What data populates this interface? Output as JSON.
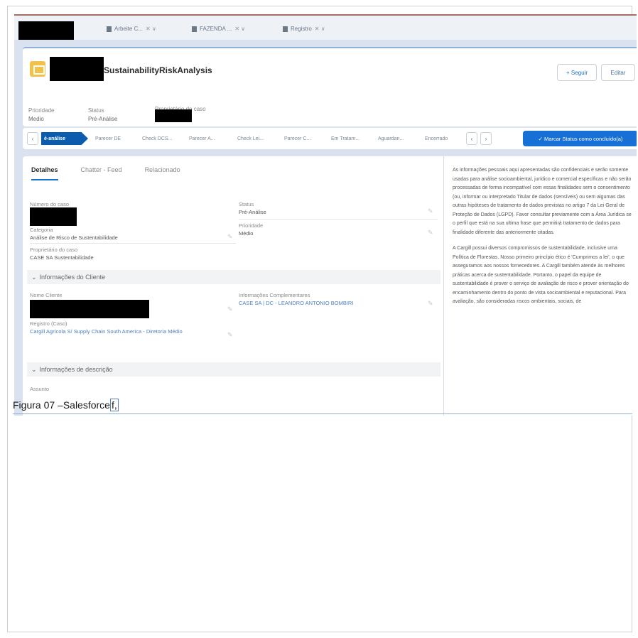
{
  "tabbar": {
    "tabs": [
      {
        "label": "Arbeite C...",
        "close": "✕ ∨"
      },
      {
        "label": "FAZENDA ...",
        "close": "✕ ∨"
      },
      {
        "label": "Registro",
        "close": "✕ ∨"
      }
    ]
  },
  "header": {
    "record_title": "SustainabilityRiskAnalysis",
    "follow_label": "+ Seguir",
    "edit_label": "Editar",
    "highlights": [
      {
        "label": "Prioridade",
        "value": "Medio"
      },
      {
        "label": "Status",
        "value": "Pré-Análise"
      },
      {
        "label": "Proprietário do caso",
        "value": ""
      }
    ]
  },
  "path": {
    "prev": "‹",
    "next": "›",
    "stages": [
      "é-análise",
      "Parecer DE",
      "Check DCS...",
      "Parecer A...",
      "Check Lei...",
      "Parecer C...",
      "Em Tratam...",
      "Aguardan...",
      "Encerrado"
    ],
    "mark_button": "✓ Marcar Status como concluído(a)"
  },
  "details": {
    "tabs": [
      "Detalhes",
      "Chatter - Feed",
      "Relacionado"
    ],
    "fields": {
      "numero_label": "Número do caso",
      "categoria_label": "Categoria",
      "categoria_value": "Análise de Risco de Sustentabilidade",
      "proprietario_label": "Proprietário do caso",
      "proprietario_value": "CASE SA Sustentabilidade",
      "status_label": "Status",
      "status_value": "Pré-Análise",
      "prioridade_label": "Prioridade",
      "prioridade_value": "Médio",
      "nome_cliente_label": "Nome Cliente",
      "registro_label": "Registro (Caso)",
      "registro_value": "Cargill Agrícola S/ Supply Chain South America - Diretoria Médio",
      "info_comp_label": "Informações Complementares",
      "info_comp_value": "CASE SA | DC - LEANDRO ANTONIO BOMBIRI",
      "assunto_label": "Assunto"
    },
    "sections": {
      "cliente": "Informações do Cliente",
      "descricao": "Informações de descrição"
    }
  },
  "right_panel": {
    "paragraphs": [
      "As informações pessoais aqui apresentadas são confidenciais e serão somente usadas para análise socioambiental, jurídico e comercial específicas e não serão processadas de forma incompatível com essas finalidades sem o consentimento (ou, informar ou interpretado Titular de dados (sensíveis) ou sem algumas das outras hipóteses de tratamento de dados previstas no artigo 7 da Lei Geral de Proteção de Dados (LGPD). Favor consultar previamente com a Área Jurídica se o perfil que está na sua ultima frase que permitirá tratamento de dados para finalidade diferente das anteriormente citadas.",
      "A Cargill possui diversos compromissos de sustentabilidade, inclusive uma Política de Florestas. Nosso primeiro princípio ético é 'Cumprimos a lei', o que asseguramos aos nossos fornecedores. A Cargill também atende às melhores práticas acerca de sustentabilidade. Portanto, o papel da equipe de sustentabilidade é prover o serviço de avaliação de risco e prover orientação do encaminhamento dentro do ponto de vista socioambiental e reputacional. Para avaliação, são consideradas riscos ambientais, sociais, de"
    ]
  },
  "caption": {
    "text": "Figura 07 –Salesforce",
    "trail": "f,"
  }
}
